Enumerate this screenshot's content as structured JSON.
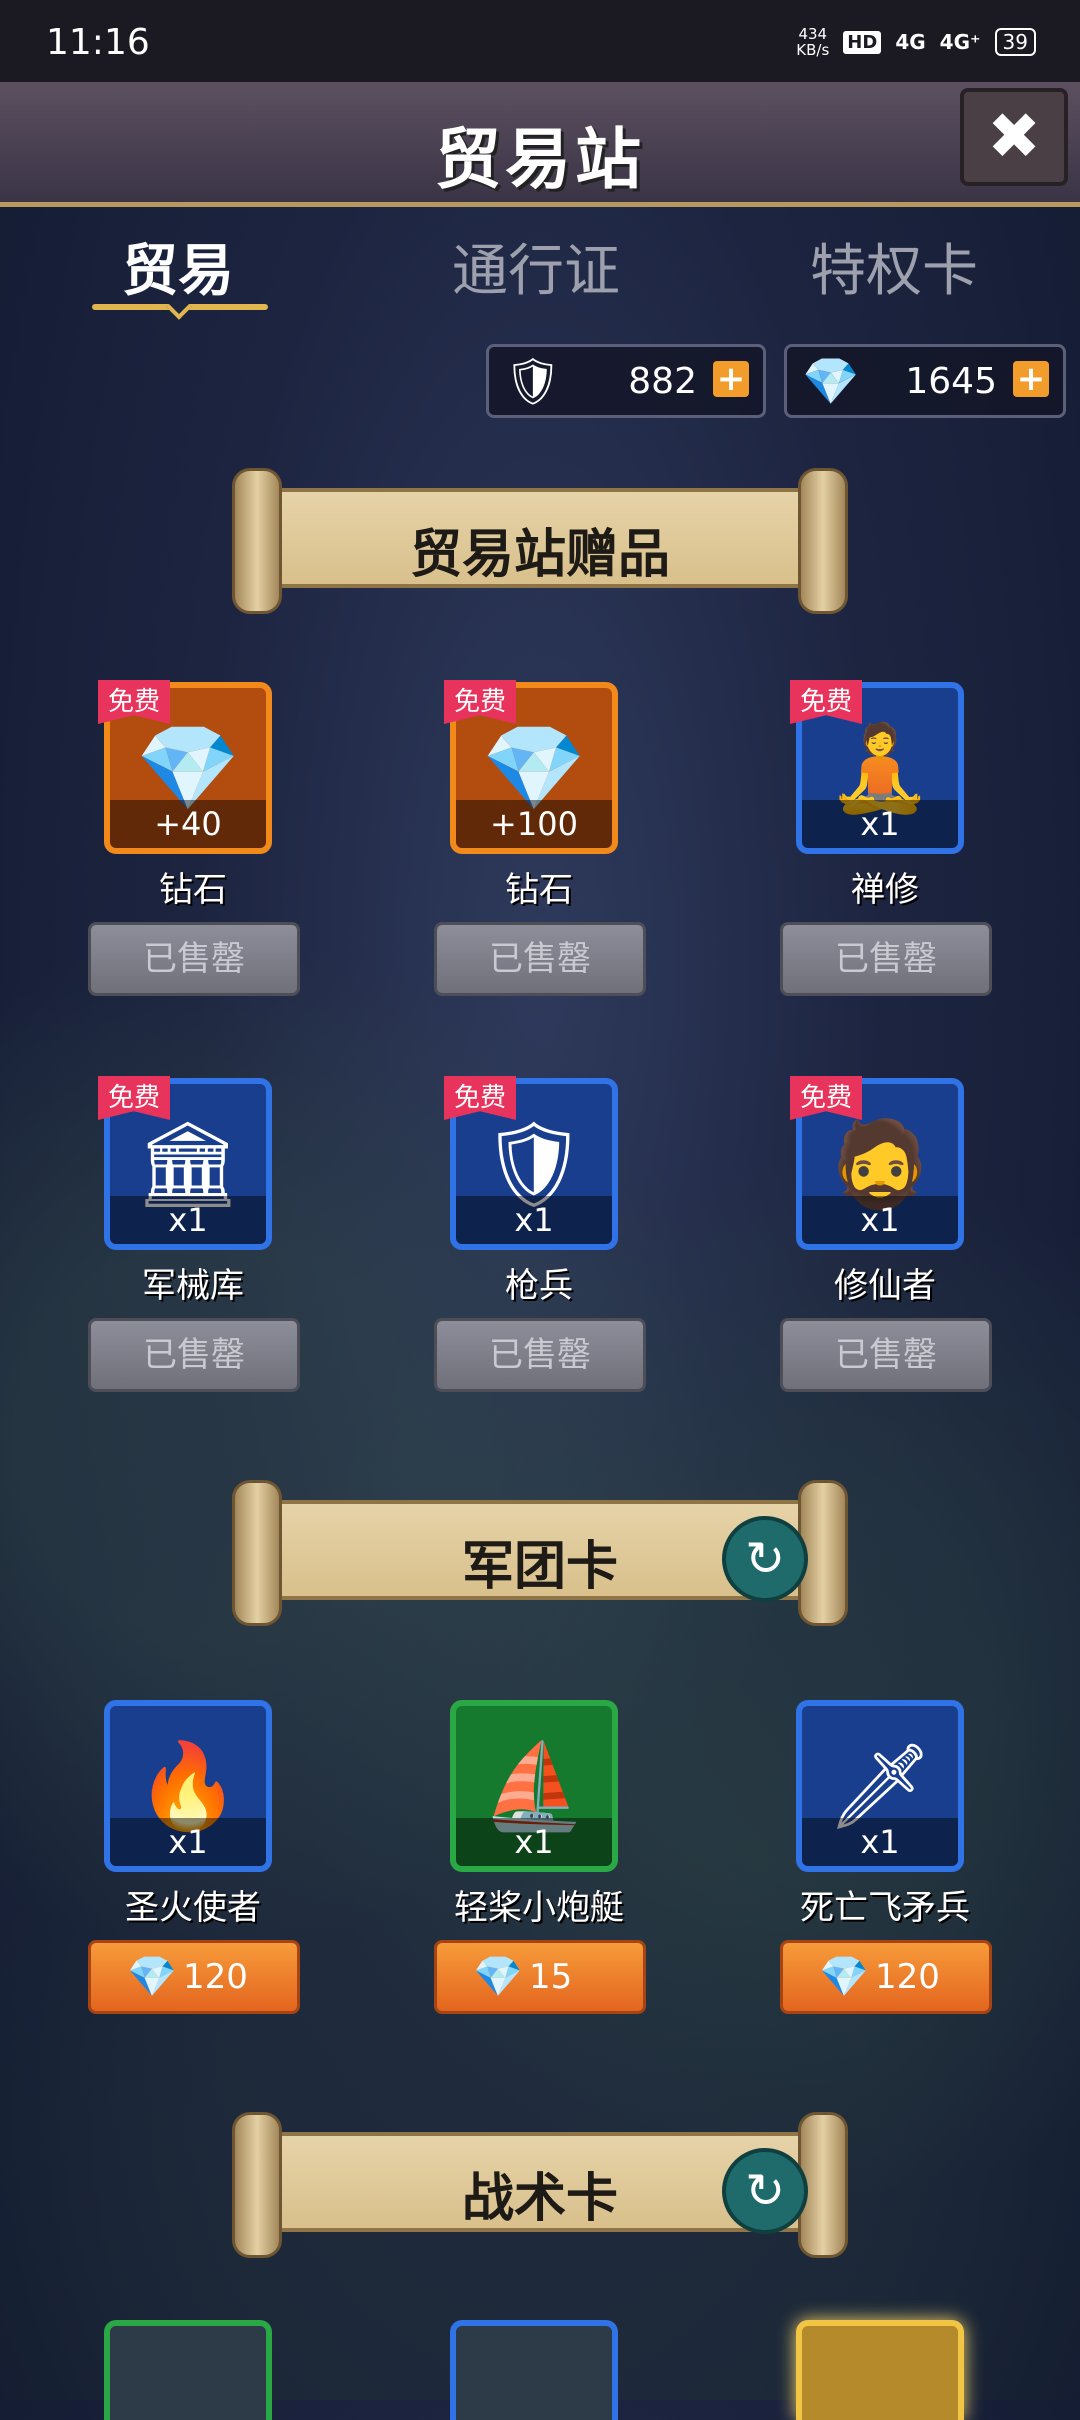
{
  "status_bar": {
    "time": "11:16",
    "net_speed_value": "434",
    "net_speed_unit": "KB/s",
    "hd": "HD",
    "sig1": "4G",
    "sig2": "4G⁺",
    "battery": "39"
  },
  "header": {
    "title": "贸易站",
    "close_icon": "close-icon"
  },
  "tabs": [
    {
      "label": "贸易"
    },
    {
      "label": "通行证"
    },
    {
      "label": "特权卡"
    }
  ],
  "currency": [
    {
      "icon": "crest-icon",
      "glyph": "🛡",
      "value": "882"
    },
    {
      "icon": "diamond-icon",
      "glyph": "💎",
      "value": "1645"
    }
  ],
  "sections": {
    "gifts": {
      "title": "贸易站赠品"
    },
    "legion": {
      "title": "军团卡",
      "refresh_icon": "refresh-icon"
    },
    "tactics": {
      "title": "战术卡",
      "refresh_icon": "refresh-icon"
    }
  },
  "free_tag": "免费",
  "sold_out": "已售罄",
  "gift_items": [
    {
      "name": "钻石",
      "qty": "+40",
      "color": "orange",
      "icon": "diamond-icon",
      "glyph": "💎"
    },
    {
      "name": "钻石",
      "qty": "+100",
      "color": "orange",
      "icon": "diamond-icon",
      "glyph": "💎"
    },
    {
      "name": "禅修",
      "qty": "x1",
      "color": "blue",
      "icon": "monk-icon",
      "glyph": "🧘"
    },
    {
      "name": "军械库",
      "qty": "x1",
      "color": "blue",
      "icon": "armory-icon",
      "glyph": "🏛"
    },
    {
      "name": "枪兵",
      "qty": "x1",
      "color": "blue",
      "icon": "spearman-icon",
      "glyph": "🛡"
    },
    {
      "name": "修仙者",
      "qty": "x1",
      "color": "blue",
      "icon": "cultivator-icon",
      "glyph": "🧔"
    }
  ],
  "legion_items": [
    {
      "name": "圣火使者",
      "qty": "x1",
      "color": "blue",
      "icon": "fire-envoy-icon",
      "glyph": "🔥",
      "price": "120"
    },
    {
      "name": "轻桨小炮艇",
      "qty": "x1",
      "color": "green",
      "icon": "gunboat-icon",
      "glyph": "⛵",
      "price": "15"
    },
    {
      "name": "死亡飞矛兵",
      "qty": "x1",
      "color": "blue",
      "icon": "javelin-icon",
      "glyph": "🗡",
      "price": "120"
    }
  ],
  "price_icon": "diamond-icon",
  "price_glyph": "💎",
  "colors": {
    "orange": "#f28a1b",
    "blue": "#2f73e6",
    "green": "#2aa845",
    "accent": "#e2b64f",
    "free_tag": "#e8345c"
  }
}
